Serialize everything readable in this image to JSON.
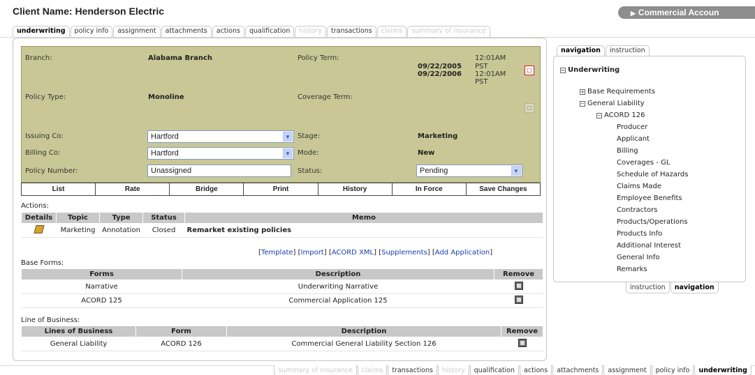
{
  "client_label": "Client Name: Henderson Electric",
  "commercial_label": "Commercial Accoun",
  "top_tabs": [
    {
      "label": "underwriting",
      "state": "active"
    },
    {
      "label": "policy info",
      "state": "normal"
    },
    {
      "label": "assignment",
      "state": "normal"
    },
    {
      "label": "attachments",
      "state": "normal"
    },
    {
      "label": "actions",
      "state": "normal"
    },
    {
      "label": "qualification",
      "state": "normal"
    },
    {
      "label": "history",
      "state": "disabled"
    },
    {
      "label": "transactions",
      "state": "normal"
    },
    {
      "label": "claims",
      "state": "disabled"
    },
    {
      "label": "summary of insurance",
      "state": "disabled"
    }
  ],
  "bottom_tabs": [
    {
      "label": "summary of insurance",
      "state": "disabled"
    },
    {
      "label": "claims",
      "state": "disabled"
    },
    {
      "label": "transactions",
      "state": "normal"
    },
    {
      "label": "history",
      "state": "disabled"
    },
    {
      "label": "qualification",
      "state": "normal"
    },
    {
      "label": "actions",
      "state": "normal"
    },
    {
      "label": "attachments",
      "state": "normal"
    },
    {
      "label": "assignment",
      "state": "normal"
    },
    {
      "label": "policy info",
      "state": "normal"
    },
    {
      "label": "underwriting",
      "state": "active"
    }
  ],
  "policy": {
    "branch_label": "Branch:",
    "branch_value": "Alabama Branch",
    "policy_term_label": "Policy Term:",
    "term_date1": "09/22/2005",
    "term_date2": "09/22/2006",
    "term_time1a": "12:01AM",
    "term_time1b": "PST",
    "term_time2a": "12:01AM",
    "term_time2b": "PST",
    "policy_type_label": "Policy Type:",
    "policy_type_value": "Monoline",
    "coverage_term_label": "Coverage Term:",
    "issuing_label": "Issuing Co:",
    "issuing_value": "Hartford",
    "billing_label": "Billing Co:",
    "billing_value": "Hartford",
    "number_label": "Policy Number:",
    "number_value": "Unassigned",
    "stage_label": "Stage:",
    "stage_value": "Marketing",
    "mode_label": "Mode:",
    "mode_value": "New",
    "status_label": "Status:",
    "status_value": "Pending"
  },
  "buttons": [
    "List",
    "Rate",
    "Bridge",
    "Print",
    "History",
    "In Force",
    "Save Changes"
  ],
  "actions": {
    "label": "Actions:",
    "headers": [
      "Details",
      "Topic",
      "Type",
      "Status",
      "Memo"
    ],
    "row": {
      "topic": "Marketing",
      "type": "Annotation",
      "status": "Closed",
      "memo": "Remarket existing policies"
    }
  },
  "links": [
    "Template",
    "Import",
    "ACORD XML",
    "Supplements",
    "Add Application"
  ],
  "base_forms": {
    "label": "Base Forms:",
    "headers": [
      "Forms",
      "Description",
      "Remove"
    ],
    "rows": [
      {
        "form": "Narrative",
        "description": "Underwriting Narrative"
      },
      {
        "form": "ACORD 125",
        "description": "Commercial Application 125"
      }
    ]
  },
  "lob": {
    "label": "Line of Business:",
    "headers": [
      "Lines of Business",
      "Form",
      "Description",
      "Remove"
    ],
    "rows": [
      {
        "line": "General Liability",
        "form": "ACORD 126",
        "description": "Commercial General Liability Section 126"
      }
    ]
  },
  "nav": {
    "tab_navigation": "navigation",
    "tab_instruction": "instruction",
    "root": "Underwriting",
    "base_requirements": "Base Requirements",
    "general_liability": "General Liability",
    "acord126": "ACORD 126",
    "leaves": [
      "Producer",
      "Applicant",
      "Billing",
      "Coverages - GL",
      "Schedule of Hazards",
      "Claims Made",
      "Employee Benefits",
      "Contractors",
      "Products/Operations",
      "Products Info",
      "Additional Interest",
      "General Info",
      "Remarks"
    ]
  }
}
